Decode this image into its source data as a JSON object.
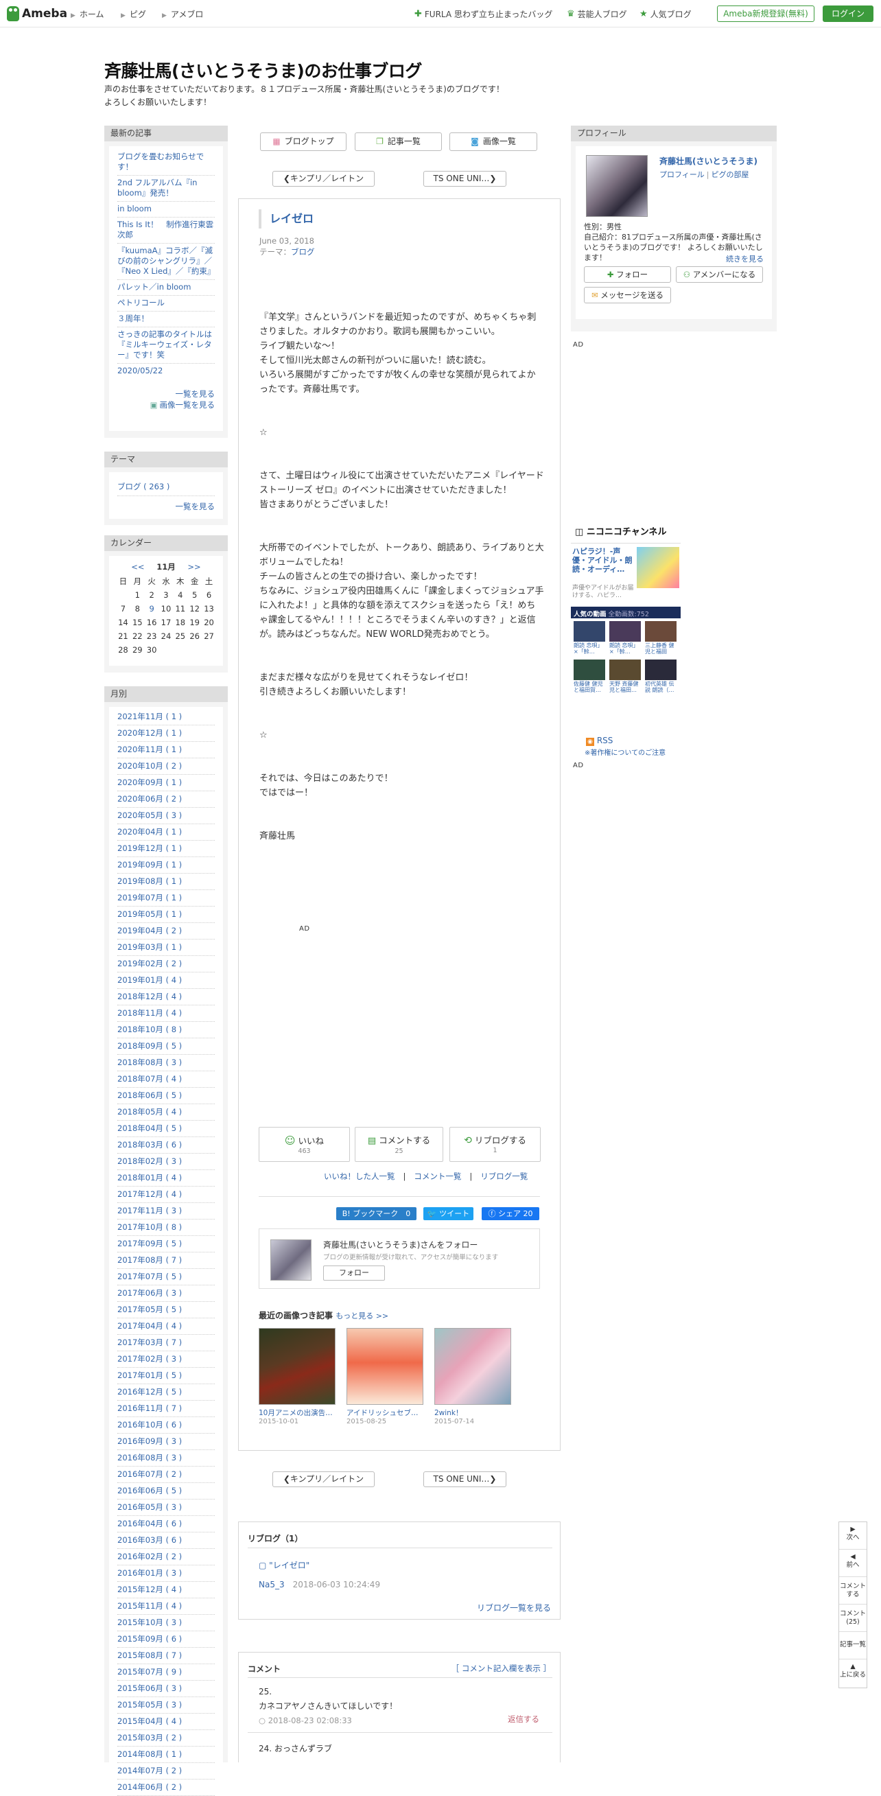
{
  "topbar": {
    "logo": "Ameba",
    "nav": [
      "ホーム",
      "ピグ",
      "アメブロ"
    ],
    "links": [
      "FURLA 思わず立ち止まったバッグ",
      "芸能人ブログ",
      "人気ブログ"
    ],
    "register": "Ameba新規登録(無料)",
    "login": "ログイン",
    "accent": "#3c9b3c"
  },
  "blog": {
    "title": "斉藤壮馬(さいとうそうま)のお仕事ブログ",
    "desc1": "声のお仕事をさせていただいております。８１プロデュース所属・斉藤壮馬(さいとうそうま)のブログです！",
    "desc2": "よろしくお願いいたします！"
  },
  "topnav": {
    "top": "ブログトップ",
    "list": "記事一覧",
    "images": "画像一覧"
  },
  "pager": {
    "prev": "キンプリ／レイトン",
    "next": "TS ONE UNI…"
  },
  "side": {
    "recent_title": "最新の記事",
    "recent": [
      "ブログを畳むお知らせです！",
      "2nd フルアルバム『in bloom』発売！",
      "in bloom",
      "This Is It！　制作進行東雲次郎",
      "『kuumaA』コラボ／『滅びの前のシャングリラ』／『Neo X Lied』／『約束』",
      "パレット／in bloom",
      "ペトリコール",
      "３周年！",
      "さっきの記事のタイトルは『ミルキーウェイズ・レター』です！笑",
      "2020/05/22"
    ],
    "recent_more": "一覧を見る",
    "recent_img": "画像一覧を見る",
    "theme_title": "テーマ",
    "theme_item": "ブログ ( 263 )",
    "theme_more": "一覧を見る",
    "cal_title": "カレンダー",
    "cal_month": "11月",
    "cal_prev": "<<",
    "cal_next": ">>",
    "cal_head": [
      "日",
      "月",
      "火",
      "水",
      "木",
      "金",
      "土"
    ],
    "cal_rows": [
      [
        "",
        "1",
        "2",
        "3",
        "4",
        "5",
        "6"
      ],
      [
        "7",
        "8",
        "9",
        "10",
        "11",
        "12",
        "13"
      ],
      [
        "14",
        "15",
        "16",
        "17",
        "18",
        "19",
        "20"
      ],
      [
        "21",
        "22",
        "23",
        "24",
        "25",
        "26",
        "27"
      ],
      [
        "28",
        "29",
        "30",
        "",
        "",
        "",
        ""
      ]
    ],
    "month_title": "月別",
    "months": [
      "2021年11月 ( 1 )",
      "2020年12月 ( 1 )",
      "2020年11月 ( 1 )",
      "2020年10月 ( 2 )",
      "2020年09月 ( 1 )",
      "2020年06月 ( 2 )",
      "2020年05月 ( 3 )",
      "2020年04月 ( 1 )",
      "2019年12月 ( 1 )",
      "2019年09月 ( 1 )",
      "2019年08月 ( 1 )",
      "2019年07月 ( 1 )",
      "2019年05月 ( 1 )",
      "2019年04月 ( 2 )",
      "2019年03月 ( 1 )",
      "2019年02月 ( 2 )",
      "2019年01月 ( 4 )",
      "2018年12月 ( 4 )",
      "2018年11月 ( 4 )",
      "2018年10月 ( 8 )",
      "2018年09月 ( 5 )",
      "2018年08月 ( 3 )",
      "2018年07月 ( 4 )",
      "2018年06月 ( 5 )",
      "2018年05月 ( 4 )",
      "2018年04月 ( 5 )",
      "2018年03月 ( 6 )",
      "2018年02月 ( 3 )",
      "2018年01月 ( 4 )",
      "2017年12月 ( 4 )",
      "2017年11月 ( 3 )",
      "2017年10月 ( 8 )",
      "2017年09月 ( 5 )",
      "2017年08月 ( 7 )",
      "2017年07月 ( 5 )",
      "2017年06月 ( 3 )",
      "2017年05月 ( 5 )",
      "2017年04月 ( 4 )",
      "2017年03月 ( 7 )",
      "2017年02月 ( 3 )",
      "2017年01月 ( 5 )",
      "2016年12月 ( 5 )",
      "2016年11月 ( 7 )",
      "2016年10月 ( 6 )",
      "2016年09月 ( 3 )",
      "2016年08月 ( 3 )",
      "2016年07月 ( 2 )",
      "2016年06月 ( 5 )",
      "2016年05月 ( 3 )",
      "2016年04月 ( 6 )",
      "2016年03月 ( 6 )",
      "2016年02月 ( 2 )",
      "2016年01月 ( 3 )",
      "2015年12月 ( 4 )",
      "2015年11月 ( 4 )",
      "2015年10月 ( 3 )",
      "2015年09月 ( 6 )",
      "2015年08月 ( 7 )",
      "2015年07月 ( 9 )",
      "2015年06月 ( 3 )",
      "2015年05月 ( 3 )",
      "2015年04月 ( 4 )",
      "2015年03月 ( 2 )",
      "2014年08月 ( 1 )",
      "2014年07月 ( 2 )",
      "2014年06月 ( 2 )"
    ]
  },
  "article": {
    "title": "レイゼロ",
    "date": "June 03, 2018",
    "theme_label": "テーマ：",
    "theme": "ブログ",
    "body": [
      "『羊文学』さんというバンドを最近知ったのですが、めちゃくちゃ刺さりました。オルタナのかおり。歌詞も展開もかっこいい。",
      "ライブ観たいな〜！",
      "そして恒川光太郎さんの新刊がついに届いた！読む読む。",
      "いろいろ展開がすごかったですが牧くんの幸せな笑顔が見られてよかったです。斉藤壮馬です。",
      "",
      "",
      "☆",
      "",
      "",
      "さて、土曜日はウィル役にて出演させていただいたアニメ『レイヤードストーリーズ ゼロ』のイベントに出演させていただきました！",
      "皆さまありがとうございました！",
      "",
      "",
      "大所帯でのイベントでしたが、トークあり、朗読あり、ライブありと大ボリュームでしたね！",
      "チームの皆さんとの生での掛け合い、楽しかったです！",
      "ちなみに、ジョシュア役内田雄馬くんに「課金しまくってジョシュア手に入れたよ！」と具体的な額を添えてスクショを送ったら「え！めちゃ課金してるやん！！！！ところでそうまくん辛いのすき？」と返信が。読みはどっちなんだ。NEW WORLD発売おめでとう。",
      "",
      "",
      "まだまだ様々な広がりを見せてくれそうなレイゼロ！",
      "引き続きよろしくお願いいたします！",
      "",
      "",
      "☆",
      "",
      "",
      "それでは、今日はこのあたりで！",
      "ではではー！",
      "",
      "",
      "斉藤壮馬"
    ],
    "ad": "AD",
    "like": "いいね",
    "like_n": "463",
    "comment": "コメントする",
    "comment_n": "25",
    "reblog": "リブログする",
    "reblog_n": "1",
    "links": [
      "いいね！した人一覧",
      "コメント一覧",
      "リブログ一覧"
    ],
    "share": {
      "hatena": "B! ブックマーク",
      "hatena_n": "0",
      "tweet": "ツイート",
      "fb": "シェア",
      "fb_n": "20"
    },
    "follow_text": "斉藤壮馬(さいとうそうま)さんをフォロー",
    "follow_sub": "ブログの更新情報が受け取れて、アクセスが簡単になります",
    "follow_btn": "フォロー",
    "recent_img_title": "最近の画像つき記事",
    "recent_img_more": "もっと見る >>",
    "thumbs": [
      {
        "title": "10月アニメの出演告…",
        "date": "2015-10-01"
      },
      {
        "title": "アイドリッシュセブ…",
        "date": "2015-08-25"
      },
      {
        "title": "2wink！",
        "date": "2015-07-14"
      }
    ]
  },
  "reblog_sec": {
    "title": "リブログ（1）",
    "item": "\"レイゼロ\"",
    "user": "Na5_3",
    "date": "2018-06-03 10:24:49",
    "more": "リブログ一覧を見る"
  },
  "comments": {
    "title": "コメント",
    "open": "［ コメント記入欄を表示 ］",
    "c1_num": "25.",
    "c1_text": "カネコアヤノさんきいてほしいです！",
    "c1_date": "2018-08-23 02:08:33",
    "reply": "返信する",
    "c2": "24. おっさんずラブ"
  },
  "profile": {
    "title": "プロフィール",
    "name": "斉藤壮馬(さいとうそうま)",
    "link1": "プロフィール",
    "link2": "ピグの部屋",
    "gender": "性別：男性",
    "intro": "自己紹介：81プロデュース所属の声優・斉藤壮馬(さいとうそうま)のブログです！ よろしくお願いいたします！",
    "more": "続きを見る",
    "follow": "フォロー",
    "member": "アメンバーになる",
    "msg": "メッセージを送る"
  },
  "nico": {
    "brand": "ニコニコチャンネル",
    "title": "ハピラジ！-声優・アイドル・朗読・オーディ…",
    "desc": "声優やアイドルがお届けする、ハピラ…",
    "bar": "人気の動画",
    "count": "全動画数:752",
    "thumbs": [
      "朗読 恋唄」×「斡…",
      "朗読 恋唄」×「斡…",
      "三上静香 健児と福田賀…",
      "佐藤健 健児と福田賀…",
      "天野 斉藤健児と福田…",
      "初代英雄 伝説 朗読（…"
    ],
    "rss": "RSS",
    "copyright": "※著作権についてのご注意"
  },
  "floatnav": [
    "次へ",
    "前へ",
    "コメントする",
    "コメント(25)",
    "記事一覧",
    "上に戻る"
  ]
}
